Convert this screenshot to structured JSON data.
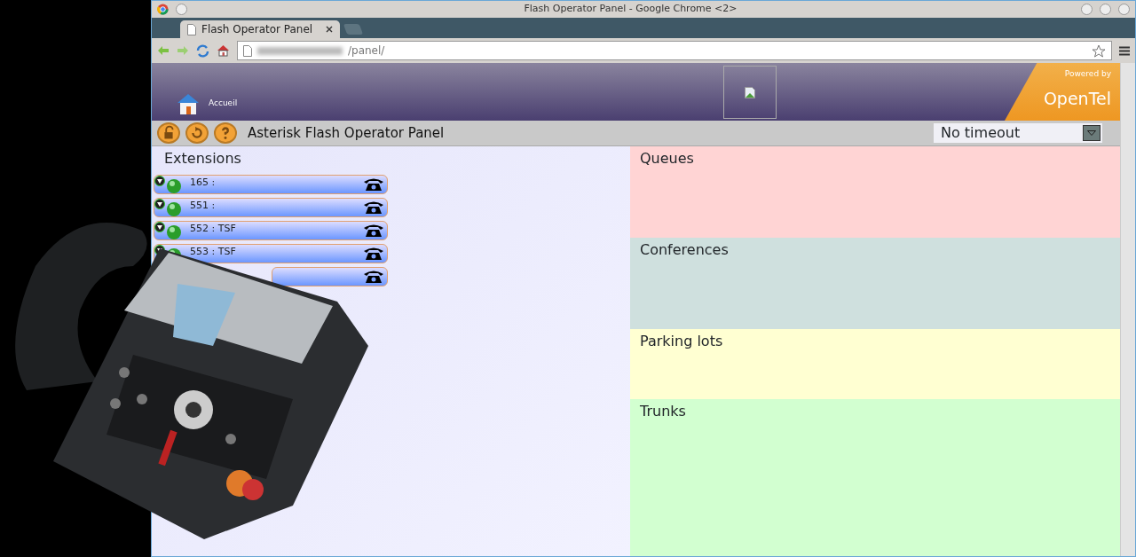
{
  "window": {
    "title": "Flash Operator Panel - Google Chrome <2>"
  },
  "tabs": [
    {
      "label": "Flash Operator Panel",
      "selected": true
    }
  ],
  "address_bar": {
    "value": "/panel/"
  },
  "header": {
    "home_label": "Accueil",
    "powered_by": "Powered by",
    "brand": "OpenTel"
  },
  "panel_title": "Asterisk Flash Operator Panel",
  "timeout_select": {
    "value": "No timeout"
  },
  "extensions": {
    "title": "Extensions",
    "items": [
      {
        "kind": "labelled",
        "label": "165 :"
      },
      {
        "kind": "labelled",
        "label": "551 :"
      },
      {
        "kind": "labelled",
        "label": "552 : TSF"
      },
      {
        "kind": "labelled",
        "label": "553 : TSF"
      },
      {
        "kind": "covered"
      }
    ]
  },
  "sections": [
    {
      "title": "Queues",
      "color": "#ffd4d4"
    },
    {
      "title": "Conferences",
      "color": "#cfe0de"
    },
    {
      "title": "Parking lots",
      "color": "#ffffd2"
    },
    {
      "title": "Trunks",
      "color": "#d2ffd0"
    }
  ]
}
